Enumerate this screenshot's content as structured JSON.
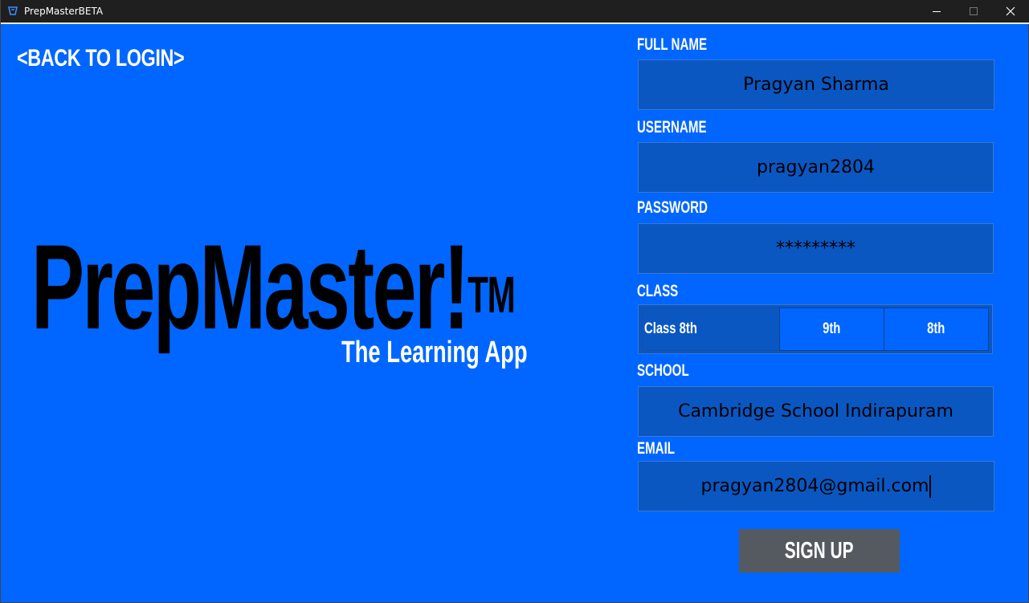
{
  "window": {
    "title": "PrepMasterBETA",
    "icon": "prepmaster-app-icon",
    "controls": {
      "minimize_icon": "minimize-icon",
      "maximize_icon": "maximize-icon",
      "close_icon": "close-icon"
    }
  },
  "left_panel": {
    "back_link": "<BACK TO LOGIN>",
    "logo_text": "PrepMaster!",
    "logo_mark": "TM",
    "tagline": "The Learning App"
  },
  "form": {
    "full_name": {
      "label": "FULL NAME",
      "value": "Pragyan Sharma"
    },
    "username": {
      "label": "USERNAME",
      "value": "pragyan2804"
    },
    "password": {
      "label": "PASSWORD",
      "value": "*********"
    },
    "class": {
      "label": "CLASS",
      "selected": "Class 8th",
      "options": [
        "9th",
        "8th"
      ]
    },
    "school": {
      "label": "SCHOOL",
      "value": "Cambridge School Indirapuram"
    },
    "email": {
      "label": "EMAIL",
      "value": "pragyan2804@gmail.com"
    },
    "submit_label": "SIGN UP"
  },
  "colors": {
    "background": "#0066ff",
    "field_background": "#0a57c2",
    "button_background": "#555a60",
    "titlebar": "#1f1f1f"
  }
}
